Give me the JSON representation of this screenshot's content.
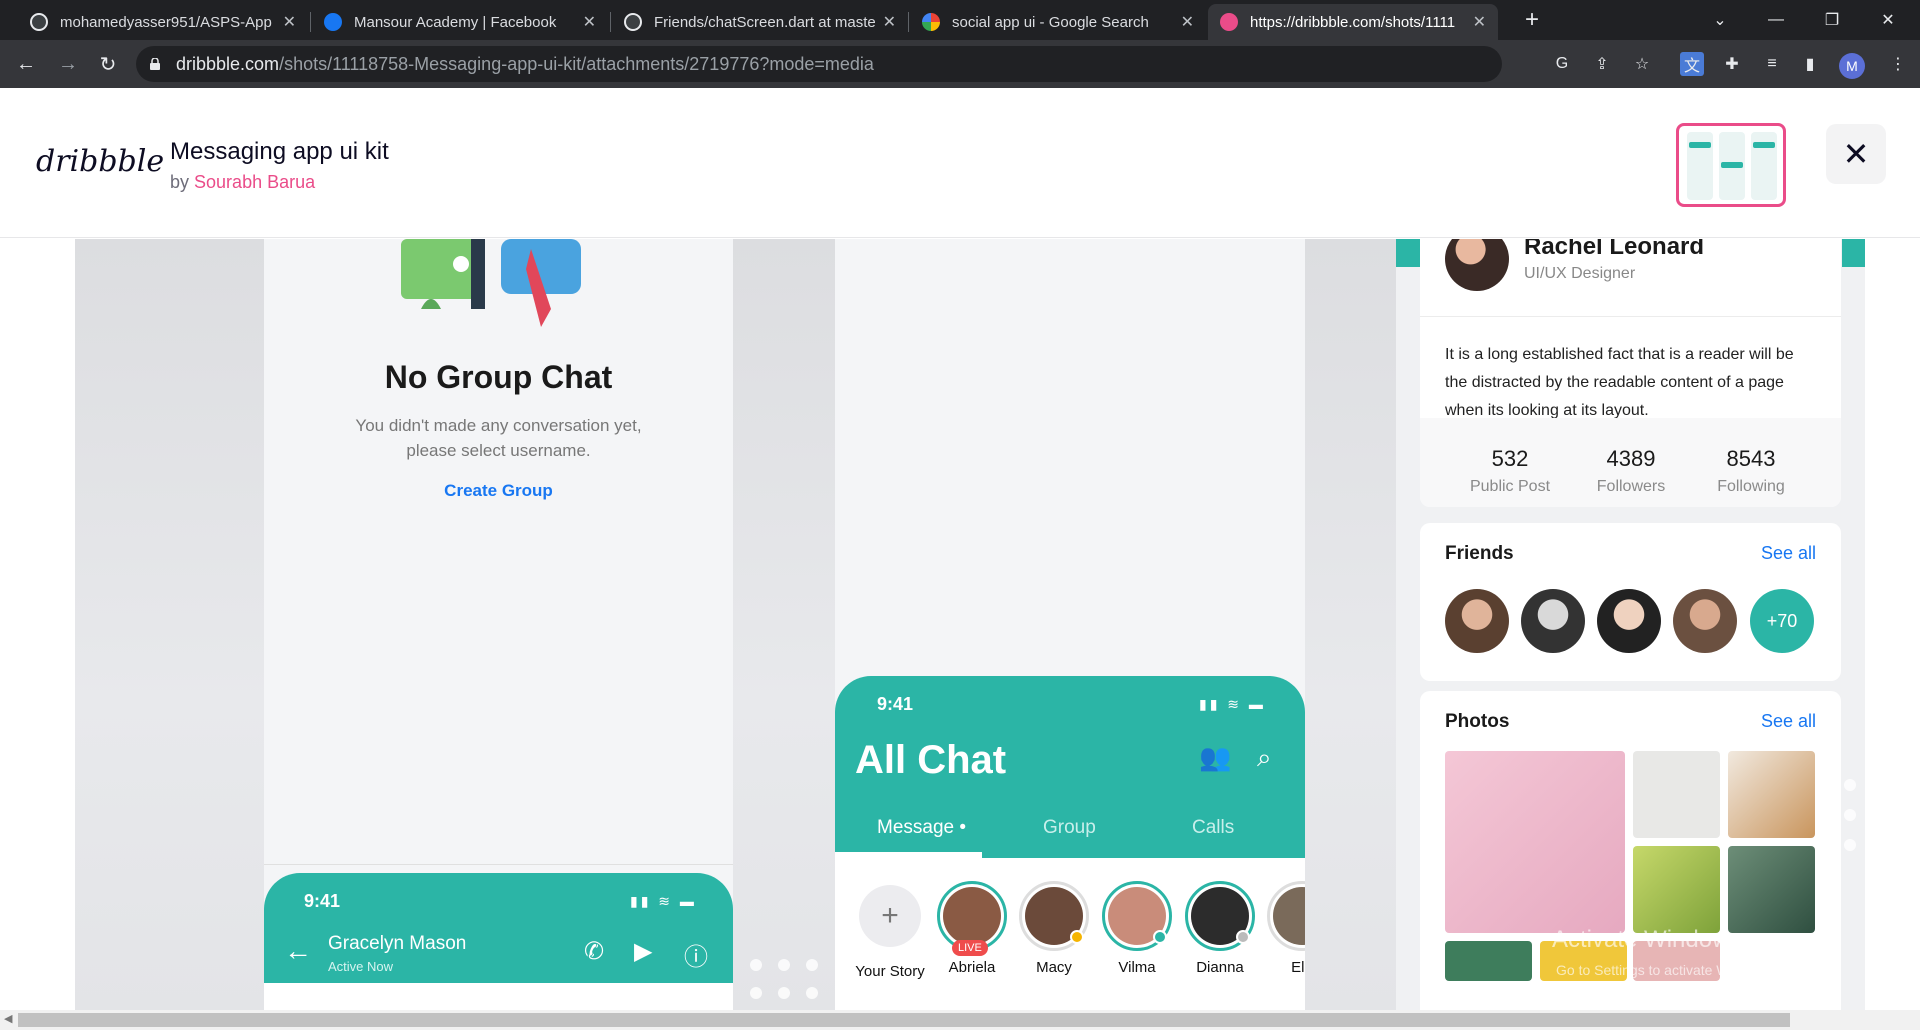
{
  "browser": {
    "tabs": [
      {
        "title": "mohamedyasser951/ASPS-App",
        "favicon_color": "#e8eaed"
      },
      {
        "title": "Mansour Academy | Facebook",
        "favicon_color": "#1877f2"
      },
      {
        "title": "Friends/chatScreen.dart at maste",
        "favicon_color": "#e8eaed"
      },
      {
        "title": "social app ui - Google Search",
        "favicon_color": "#ffffff"
      },
      {
        "title": "https://dribbble.com/shots/1111",
        "favicon_color": "#ea4c89"
      }
    ],
    "url_host": "dribbble.com",
    "url_path": "/shots/11118758-Messaging-app-ui-kit/attachments/2719776?mode=media",
    "profile_initial": "M"
  },
  "shot": {
    "logo": "dribbble",
    "title": "Messaging app ui kit",
    "by_prefix": "by",
    "author": "Sourabh Barua"
  },
  "empty_state": {
    "title": "No Group Chat",
    "subtitle": "You didn't made any conversation yet, please select username.",
    "action": "Create Group"
  },
  "all_chat": {
    "time": "9:41",
    "title": "All Chat",
    "tabs": [
      "Message",
      "Group",
      "Calls"
    ],
    "stories": [
      {
        "name": "Your Story",
        "type": "add"
      },
      {
        "name": "Abriela",
        "badge": "LIVE",
        "color": "#8a5a44"
      },
      {
        "name": "Macy",
        "status_color": "#f5b400",
        "color": "#6b4a3a"
      },
      {
        "name": "Vilma",
        "status_color": "#2bb5a6",
        "color": "#c98c7a"
      },
      {
        "name": "Dianna",
        "status_color": "#bbbbbb",
        "color": "#2c2c2c"
      },
      {
        "name": "Eln",
        "color": "#7a6a5a"
      }
    ]
  },
  "conversation": {
    "time": "9:41",
    "name": "Gracelyn Mason",
    "status": "Active Now"
  },
  "profile": {
    "name": "Rachel Leonard",
    "role": "UI/UX Designer",
    "bio": "It is a long established fact that is a reader will be the distracted by the readable content of a page when its looking at its layout.",
    "stats": [
      {
        "value": "532",
        "label": "Public Post"
      },
      {
        "value": "4389",
        "label": "Followers"
      },
      {
        "value": "8543",
        "label": "Following"
      }
    ],
    "friends_title": "Friends",
    "friends_more": "+70",
    "photos_title": "Photos",
    "see_all": "See all"
  },
  "os_watermark": {
    "line1": "Activate Windows",
    "line2": "Go to Settings to activate Windows."
  },
  "colors": {
    "teal": "#2bb5a6",
    "pink": "#ea4c89",
    "link_blue": "#1877f2"
  }
}
